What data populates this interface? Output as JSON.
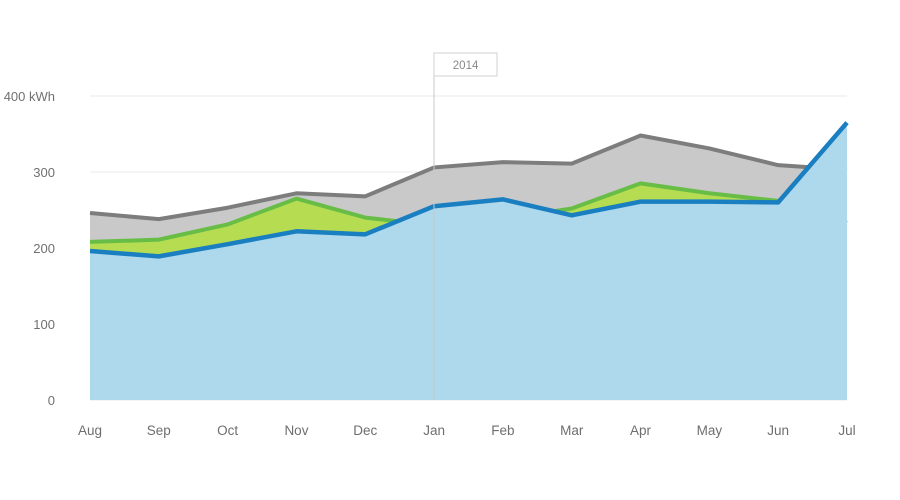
{
  "chart_data": {
    "type": "area",
    "title": "",
    "subtitle": "",
    "xlabel": "",
    "ylabel": "",
    "categories": [
      "Aug",
      "Sep",
      "Oct",
      "Nov",
      "Dec",
      "Jan",
      "Feb",
      "Mar",
      "Apr",
      "May",
      "Jun",
      "Jul"
    ],
    "ylim": [
      0,
      400
    ],
    "yticks": [
      0,
      100,
      200,
      300,
      400
    ],
    "ytick_labels": [
      "0",
      "100",
      "200",
      "300",
      "400 kWh"
    ],
    "unit": "kWh",
    "grid": true,
    "legend": "none",
    "series": [
      {
        "name": "gray-series",
        "color_fill": "#c9c9c9",
        "color_line": "#7d7d7d",
        "values": [
          246,
          238,
          253,
          272,
          268,
          306,
          313,
          311,
          348,
          331,
          309,
          303
        ]
      },
      {
        "name": "green-series",
        "color_fill": "#b6dd52",
        "color_line": "#67bd45",
        "values": [
          208,
          211,
          231,
          265,
          240,
          230,
          238,
          252,
          285,
          272,
          262,
          233
        ]
      },
      {
        "name": "blue-series",
        "color_fill": "#aed8ec",
        "color_line": "#1a7fc1",
        "values": [
          196,
          189,
          205,
          222,
          218,
          255,
          264,
          243,
          261,
          261,
          260,
          365
        ]
      }
    ],
    "annotations": [
      {
        "name": "year-marker",
        "label": "2014",
        "at_category": "Jan",
        "type": "vertical-divider-with-label"
      }
    ]
  },
  "colors": {
    "gray_fill": "#c9c9c9",
    "gray_line": "#7d7d7d",
    "green_fill": "#b6dd52",
    "green_line": "#67bd45",
    "blue_fill": "#aed8ec",
    "blue_line": "#1a7fc1",
    "gridline": "#e8e8e8",
    "divider": "#c9c9c9",
    "tick_text": "#707070",
    "background": "#ffffff"
  }
}
